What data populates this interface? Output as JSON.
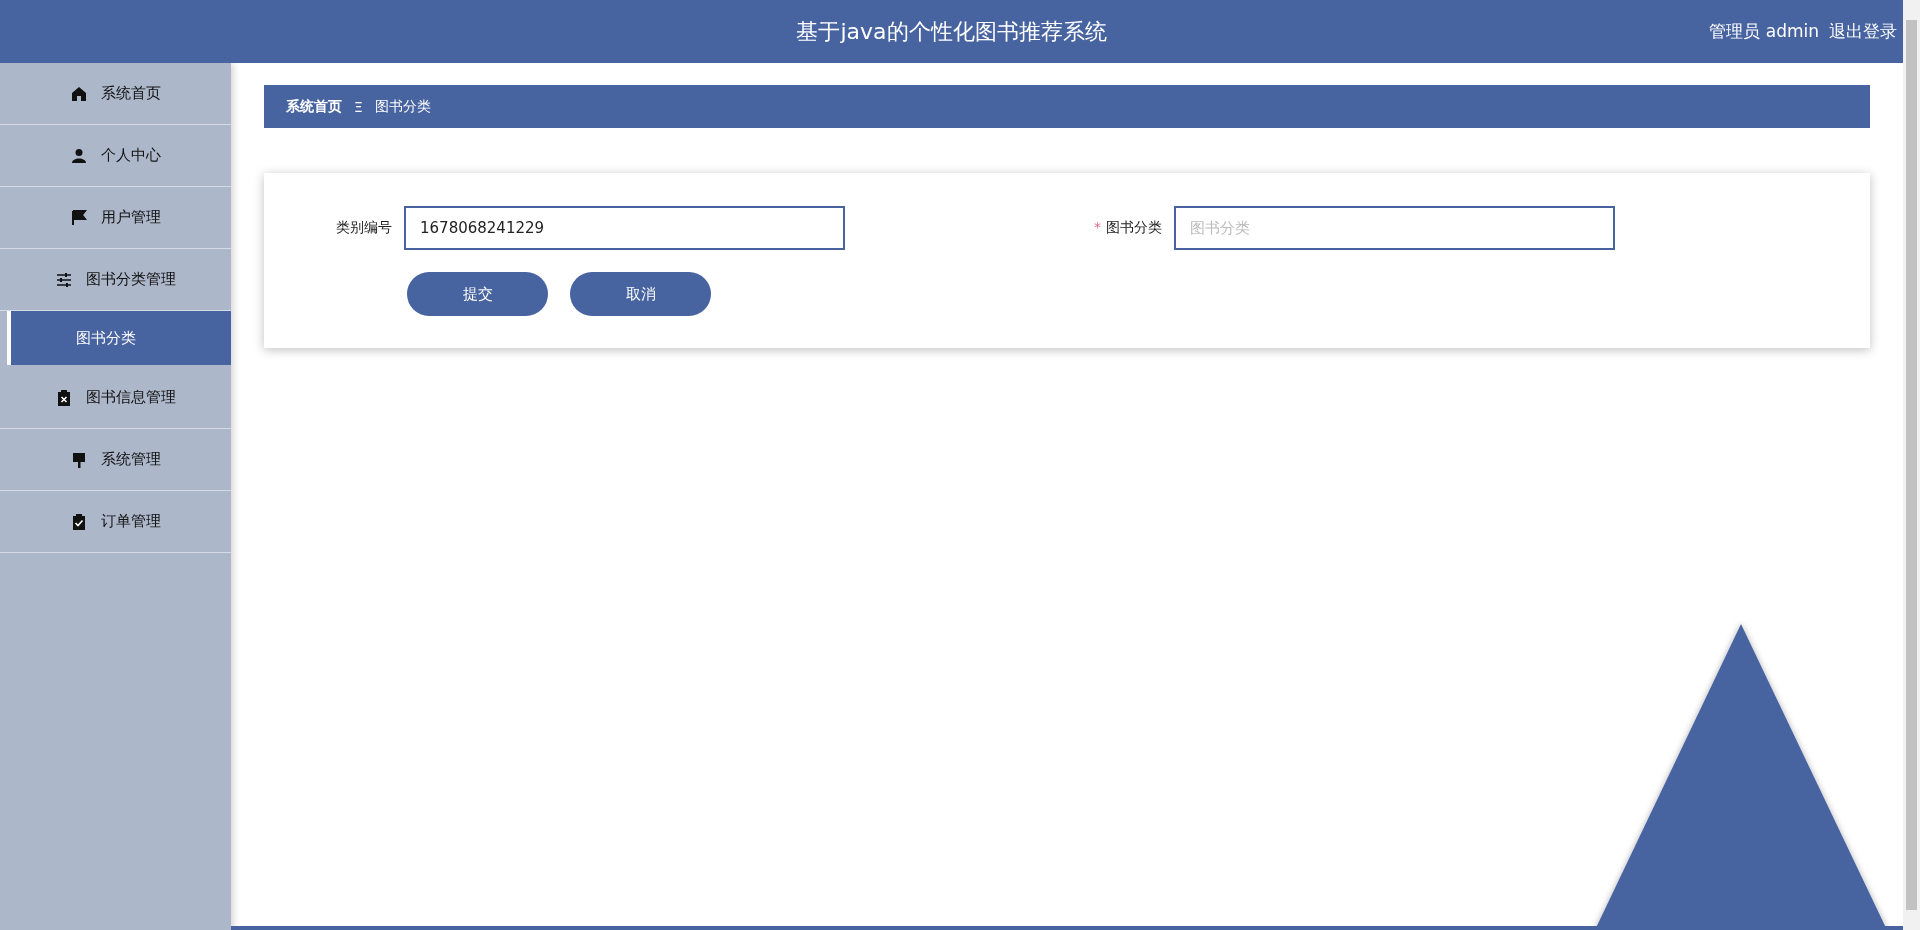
{
  "header": {
    "title": "基于java的个性化图书推荐系统",
    "user": "管理员 admin",
    "logout": "退出登录"
  },
  "sidebar": {
    "items": [
      {
        "label": "系统首页",
        "selected": false
      },
      {
        "label": "个人中心",
        "selected": false
      },
      {
        "label": "用户管理",
        "selected": false
      },
      {
        "label": "图书分类管理",
        "selected": false,
        "children": [
          {
            "label": "图书分类",
            "selected": true
          }
        ]
      },
      {
        "label": "图书信息管理",
        "selected": false
      },
      {
        "label": "系统管理",
        "selected": false
      },
      {
        "label": "订单管理",
        "selected": false
      }
    ]
  },
  "breadcrumb": {
    "home": "系统首页",
    "separator": "Ξ",
    "current": "图书分类"
  },
  "form": {
    "fields": [
      {
        "label": "类别编号",
        "value": "1678068241229"
      },
      {
        "required_mark": "*",
        "label": "图书分类",
        "placeholder": "图书分类"
      }
    ],
    "buttons": [
      "提交",
      "取消"
    ]
  }
}
